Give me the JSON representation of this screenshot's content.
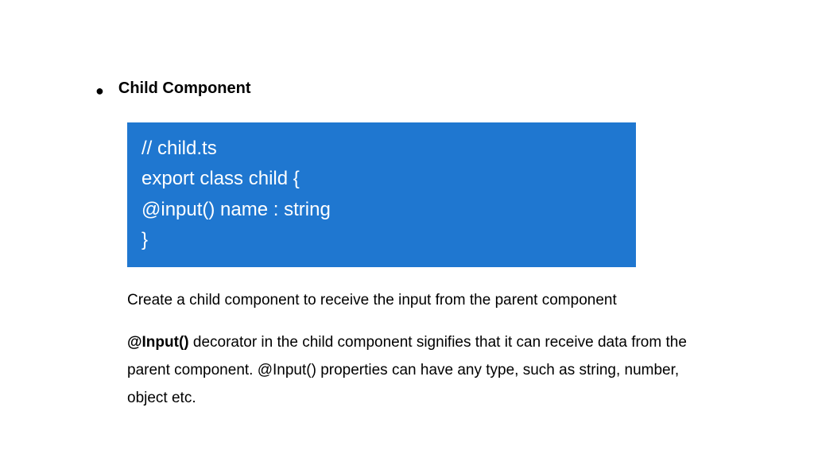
{
  "heading": "Child Component",
  "code": {
    "line1": "// child.ts",
    "line2": "export class child {",
    "line3": "@input() name : string",
    "line4": "}"
  },
  "para1": "Create a child component to receive the input from the parent component",
  "para2_lead": "@Input()",
  "para2_rest": " decorator in the child component signifies that it can receive data from the parent component. @Input() properties can have any type, such as string, number, object etc."
}
